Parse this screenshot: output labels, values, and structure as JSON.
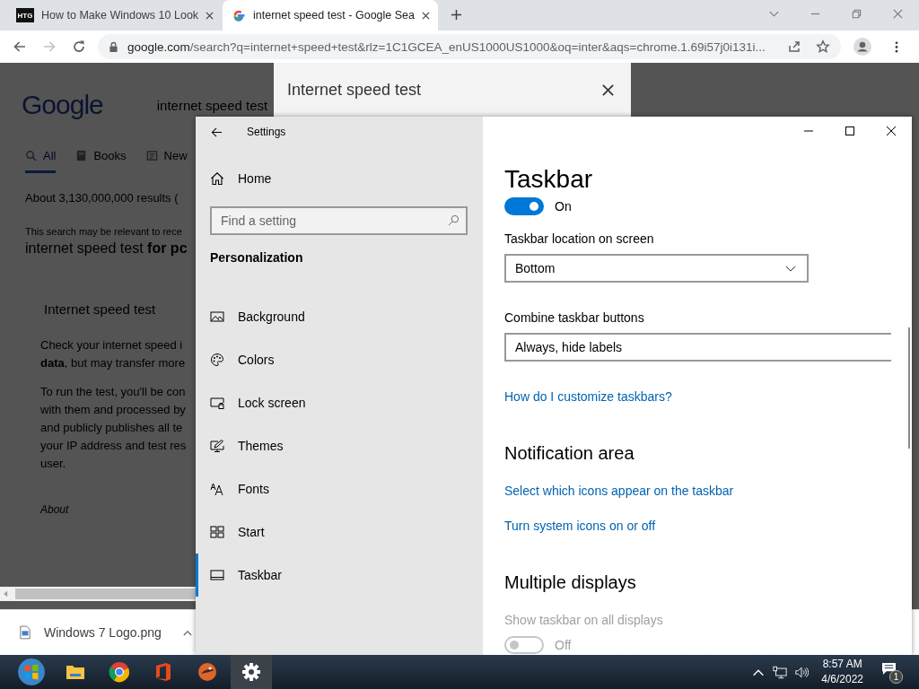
{
  "browser": {
    "tabs": [
      {
        "kind": "htg",
        "favicon_text": "HTG",
        "title": "How to Make Windows 10 Look",
        "selected": false
      },
      {
        "kind": "google",
        "title": "internet speed test - Google Sea",
        "selected": true
      }
    ],
    "nav": [
      {
        "kind": "back",
        "disabled": false
      },
      {
        "kind": "forward",
        "disabled": true
      },
      {
        "kind": "reload",
        "disabled": false
      }
    ],
    "url_host": "google.com",
    "url_path": "/search?q=internet+speed+test&rlz=1C1GCEA_enUS1000US1000&oq=inter&aqs=chrome.1.69i57j0i131i..."
  },
  "page": {
    "logo": "Google",
    "query": "internet speed test",
    "tabs": [
      {
        "kind": "search",
        "label": "All",
        "selected": true
      },
      {
        "kind": "book",
        "label": "Books",
        "selected": false
      },
      {
        "kind": "news",
        "label": "New",
        "selected": false
      }
    ],
    "results": "About 3,130,000,000 results (",
    "notice": "This search may be relevant to rece",
    "suggestion": "internet speed test **for pc**",
    "card_title": "Internet speed test",
    "paragraphs": [
      [
        "Check your internet speed i",
        "**data**, but may transfer more"
      ],
      [
        "To run the test, you'll be con",
        "with them and processed by",
        "and publicly publishes all te",
        "your IP address and test res",
        "user."
      ]
    ],
    "about": "About"
  },
  "dialog": {
    "title": "Internet speed test"
  },
  "download": {
    "file": "Windows 7 Logo.png"
  },
  "settings": {
    "title": "Settings",
    "home": "Home",
    "search_placeholder": "Find a setting",
    "section": "Personalization",
    "nav": [
      {
        "kind": "background",
        "label": "Background",
        "selected": false
      },
      {
        "kind": "colors",
        "label": "Colors",
        "selected": false
      },
      {
        "kind": "lock",
        "label": "Lock screen",
        "selected": false
      },
      {
        "kind": "themes",
        "label": "Themes",
        "selected": false
      },
      {
        "kind": "fonts",
        "label": "Fonts",
        "selected": false
      },
      {
        "kind": "start",
        "label": "Start",
        "selected": false
      },
      {
        "kind": "taskbar",
        "label": "Taskbar",
        "selected": true
      }
    ],
    "heading": "Taskbar",
    "items": [
      {
        "kind": "toggle",
        "on": true,
        "state": "On",
        "disabled": false
      },
      {
        "kind": "dropdown",
        "label": "Taskbar location on screen",
        "value": "Bottom"
      },
      {
        "kind": "dropdown",
        "label": "Combine taskbar buttons",
        "value": "Always, hide labels"
      },
      {
        "kind": "link",
        "text": "How do I customize taskbars?"
      },
      {
        "kind": "heading",
        "text": "Notification area"
      },
      {
        "kind": "link",
        "text": "Select which icons appear on the taskbar"
      },
      {
        "kind": "link",
        "text": "Turn system icons on or off"
      },
      {
        "kind": "heading",
        "text": "Multiple displays"
      },
      {
        "kind": "toggle",
        "label": "Show taskbar on all displays",
        "on": false,
        "state": "Off",
        "disabled": true
      }
    ]
  },
  "taskbar": {
    "apps": [
      {
        "kind": "start",
        "selected": false
      },
      {
        "kind": "explorer",
        "selected": false
      },
      {
        "kind": "chrome",
        "selected": false
      },
      {
        "kind": "office",
        "selected": false
      },
      {
        "kind": "bird",
        "selected": false
      },
      {
        "kind": "settings",
        "selected": true
      }
    ],
    "time": "8:57 AM",
    "date": "4/6/2022",
    "notifications": "1"
  }
}
